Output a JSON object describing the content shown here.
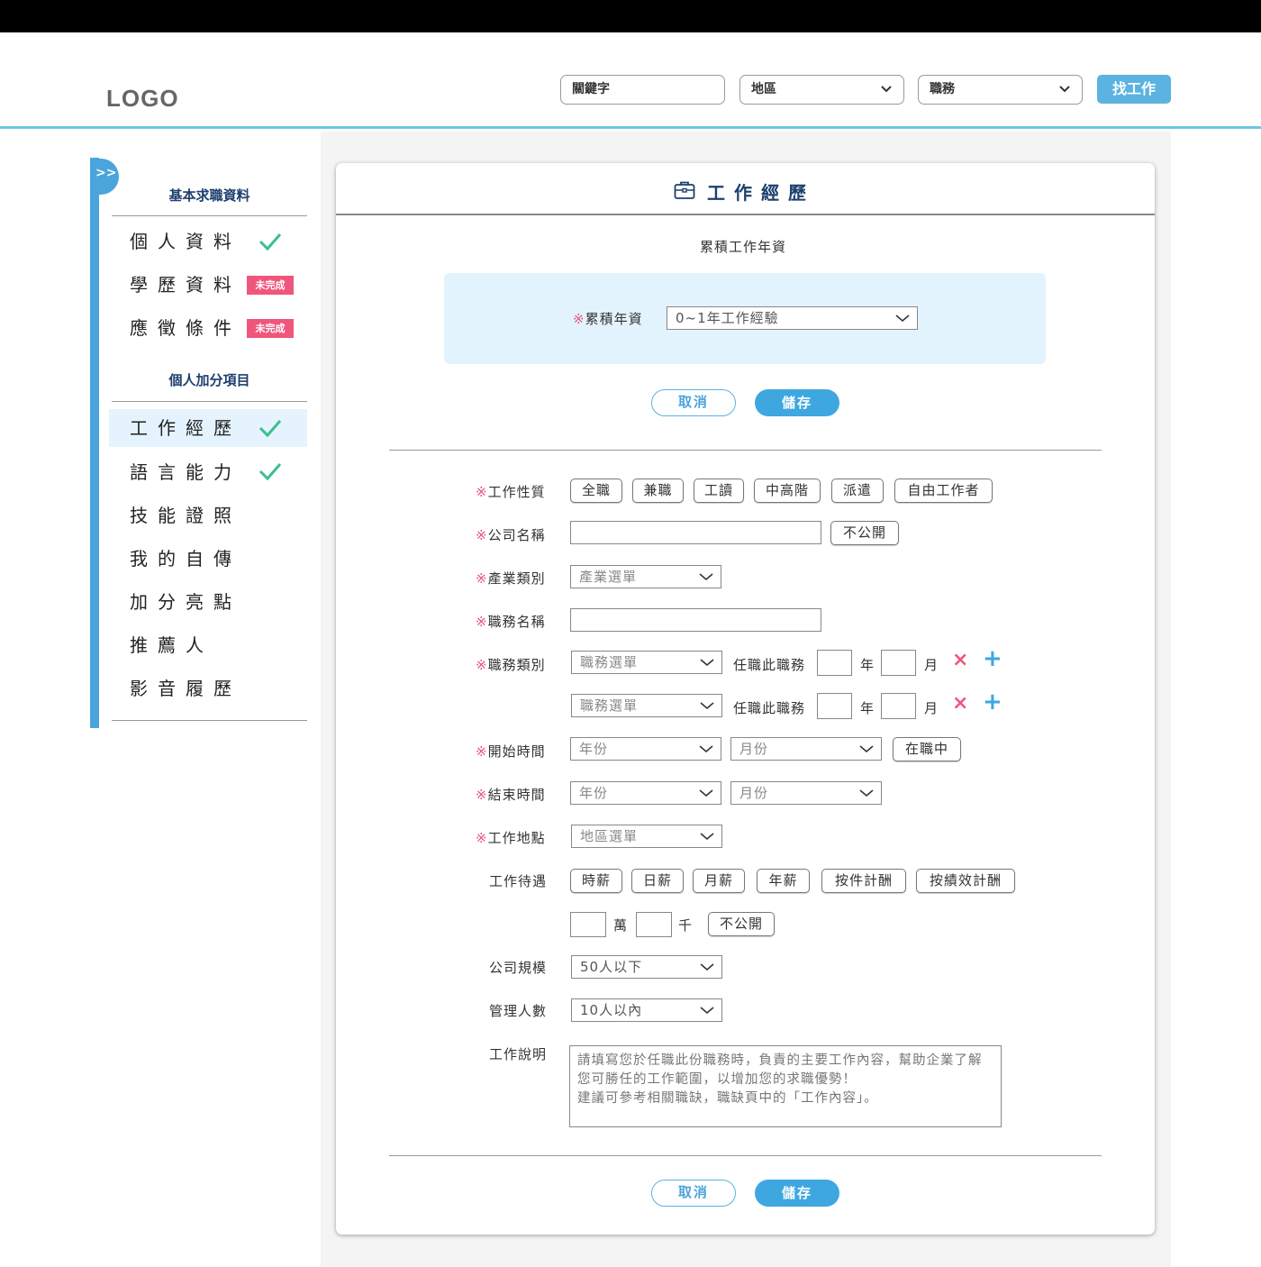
{
  "header": {
    "logo": "LOGO",
    "keyword_placeholder": "關鍵字",
    "region_label": "地區",
    "job_label": "職務",
    "search_button": "找工作"
  },
  "sidebar": {
    "toggle": ">>",
    "section1_title": "基本求職資料",
    "section1_items": [
      {
        "label": "個人資料",
        "status": "check"
      },
      {
        "label": "學歷資料",
        "status": "未完成"
      },
      {
        "label": "應徵條件",
        "status": "未完成"
      }
    ],
    "section2_title": "個人加分項目",
    "section2_items": [
      {
        "label": "工作經歷",
        "status": "check",
        "active": true
      },
      {
        "label": "語言能力",
        "status": "check"
      },
      {
        "label": "技能證照"
      },
      {
        "label": "我的自傳"
      },
      {
        "label": "加分亮點"
      },
      {
        "label": "推薦人"
      },
      {
        "label": "影音履歷"
      }
    ]
  },
  "card": {
    "title": "工作經歷",
    "seniority_heading": "累積工作年資",
    "seniority_label": "累積年資",
    "seniority_value": "0~1年工作經驗",
    "cancel": "取消",
    "save": "儲存",
    "required_mark": "※",
    "form": {
      "job_nature_label": "工作性質",
      "job_nature_options": [
        "全職",
        "兼職",
        "工讀",
        "中高階",
        "派遣",
        "自由工作者"
      ],
      "company_label": "公司名稱",
      "hide_label": "不公開",
      "industry_label": "產業類別",
      "industry_placeholder": "產業選單",
      "job_title_label": "職務名稱",
      "job_category_label": "職務類別",
      "job_category_placeholder": "職務選單",
      "tenure_label": "任職此職務",
      "year_unit": "年",
      "month_unit": "月",
      "remove_icon": "×",
      "add_icon": "+",
      "start_label": "開始時間",
      "end_label": "結束時間",
      "year_placeholder": "年份",
      "month_placeholder": "月份",
      "current_label": "在職中",
      "location_label": "工作地點",
      "location_placeholder": "地區選單",
      "salary_label": "工作待遇",
      "salary_options": [
        "時薪",
        "日薪",
        "月薪",
        "年薪",
        "按件計酬",
        "按績效計酬"
      ],
      "wan_unit": "萬",
      "qian_unit": "千",
      "size_label": "公司規模",
      "size_value": "50人以下",
      "managed_label": "管理人數",
      "managed_value": "10人以內",
      "description_label": "工作說明",
      "description_placeholder": "請填寫您於任職此份職務時，負責的主要工作內容，幫助企業了解您可勝任的工作範圍，以增加您的求職優勢！\n建議可參考相關職缺，職缺頁中的「工作內容」。"
    }
  }
}
